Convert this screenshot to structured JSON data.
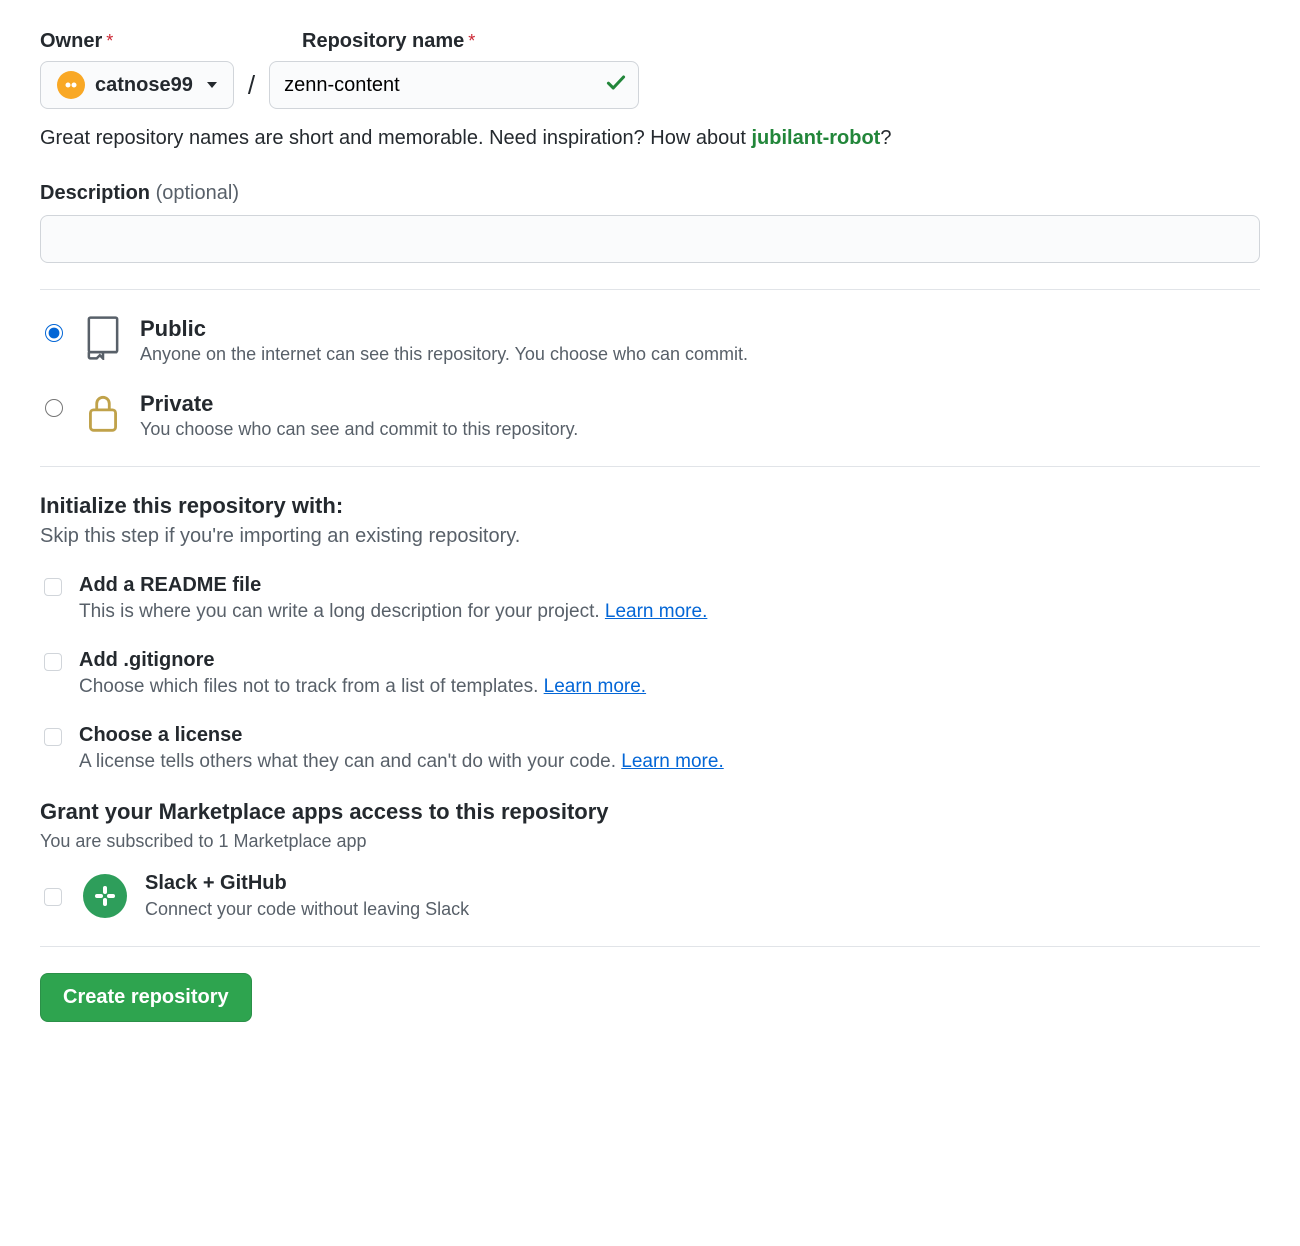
{
  "owner": {
    "label": "Owner",
    "name": "catnose99"
  },
  "repo": {
    "label": "Repository name",
    "value": "zenn-content"
  },
  "inspire": {
    "prefix": "Great repository names are short and memorable. Need inspiration? How about ",
    "suggestion": "jubilant-robot",
    "suffix": "?"
  },
  "description": {
    "label": "Description",
    "optional": "(optional)",
    "value": ""
  },
  "visibility": {
    "public": {
      "title": "Public",
      "sub": "Anyone on the internet can see this repository. You choose who can commit."
    },
    "private": {
      "title": "Private",
      "sub": "You choose who can see and commit to this repository."
    }
  },
  "init": {
    "heading": "Initialize this repository with:",
    "sub": "Skip this step if you're importing an existing repository.",
    "readme": {
      "title": "Add a README file",
      "sub": "This is where you can write a long description for your project. ",
      "link": "Learn more."
    },
    "gitignore": {
      "title": "Add .gitignore",
      "sub": "Choose which files not to track from a list of templates. ",
      "link": "Learn more."
    },
    "license": {
      "title": "Choose a license",
      "sub": "A license tells others what they can and can't do with your code. ",
      "link": "Learn more."
    }
  },
  "marketplace": {
    "heading": "Grant your Marketplace apps access to this repository",
    "sub": "You are subscribed to 1 Marketplace app",
    "app": {
      "title": "Slack + GitHub",
      "sub": "Connect your code without leaving Slack"
    }
  },
  "submit": {
    "label": "Create repository"
  }
}
